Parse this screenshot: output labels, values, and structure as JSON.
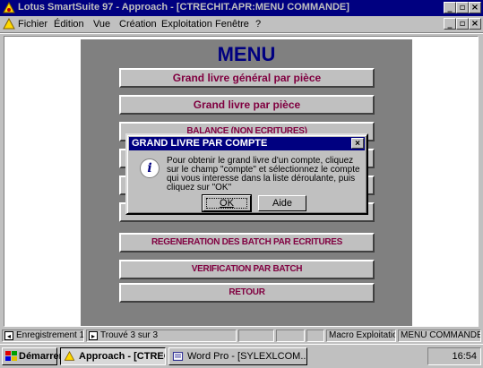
{
  "window": {
    "title": "Lotus SmartSuite 97  - Approach - [CTRECHIT.APR:MENU COMMANDE]",
    "min_label": "_",
    "max_label": "▫",
    "close_label": "×"
  },
  "menubar": {
    "items": [
      "Fichier",
      "Édition",
      "Vue",
      "Création",
      "Exploitation",
      "Fenêtre",
      "?"
    ]
  },
  "form": {
    "title": "MENU",
    "buttons": [
      "Grand livre général par pièce",
      "Grand livre par pièce",
      "BALANCE (NON ECRITURES)",
      "",
      "",
      "",
      "REGENERATION DES BATCH PAR ECRITURES",
      "VERIFICATION PAR BATCH",
      "RETOUR"
    ]
  },
  "dialog": {
    "title": "GRAND LIVRE PAR COMPTE",
    "close_label": "×",
    "icon": "info-icon",
    "icon_glyph": "i",
    "message": "Pour obtenir le grand livre d'un compte, cliquez sur le champ \"compte\" et sélectionnez le compte qui vous interesse dans la liste déroulante, puis cliquez sur \"OK\"",
    "ok_label": "OK",
    "aide_label": "Aide"
  },
  "statusbar": {
    "record": "Enregistrement 1",
    "found": "Trouvé 3 sur 3",
    "macro": "Macro Exploitation",
    "view": "MENU COMMANDE"
  },
  "taskbar": {
    "start_label": "Démarrer",
    "tasks": [
      "Approach - [CTRECR...",
      "Word Pro - [SYLEXLCOM..."
    ],
    "clock": "16:54"
  },
  "colors": {
    "title_bg": "#000080",
    "form_bg": "#808080",
    "button_text": "#800040",
    "menu_title": "#000080"
  }
}
